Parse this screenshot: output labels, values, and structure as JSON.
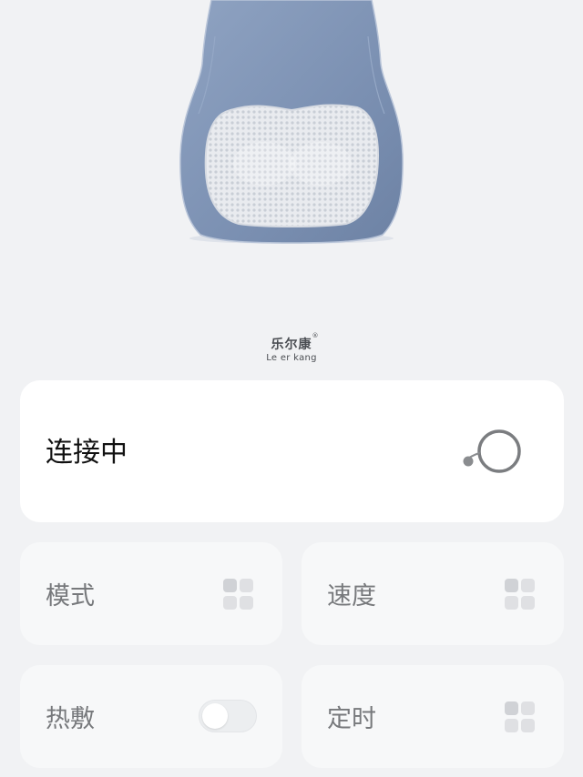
{
  "brand": {
    "name_cn": "乐尔康",
    "registered_mark": "®",
    "name_en": "Le er kang"
  },
  "device": {
    "status_label": "连接中"
  },
  "controls": {
    "mode_label": "模式",
    "speed_label": "速度",
    "heat_label": "热敷",
    "timer_label": "定时",
    "heat_on": false
  },
  "colors": {
    "page_bg": "#f1f2f4",
    "cushion_blue": "#8296b7",
    "card_bg": "#ffffff",
    "tile_bg": "#f7f8f9"
  }
}
